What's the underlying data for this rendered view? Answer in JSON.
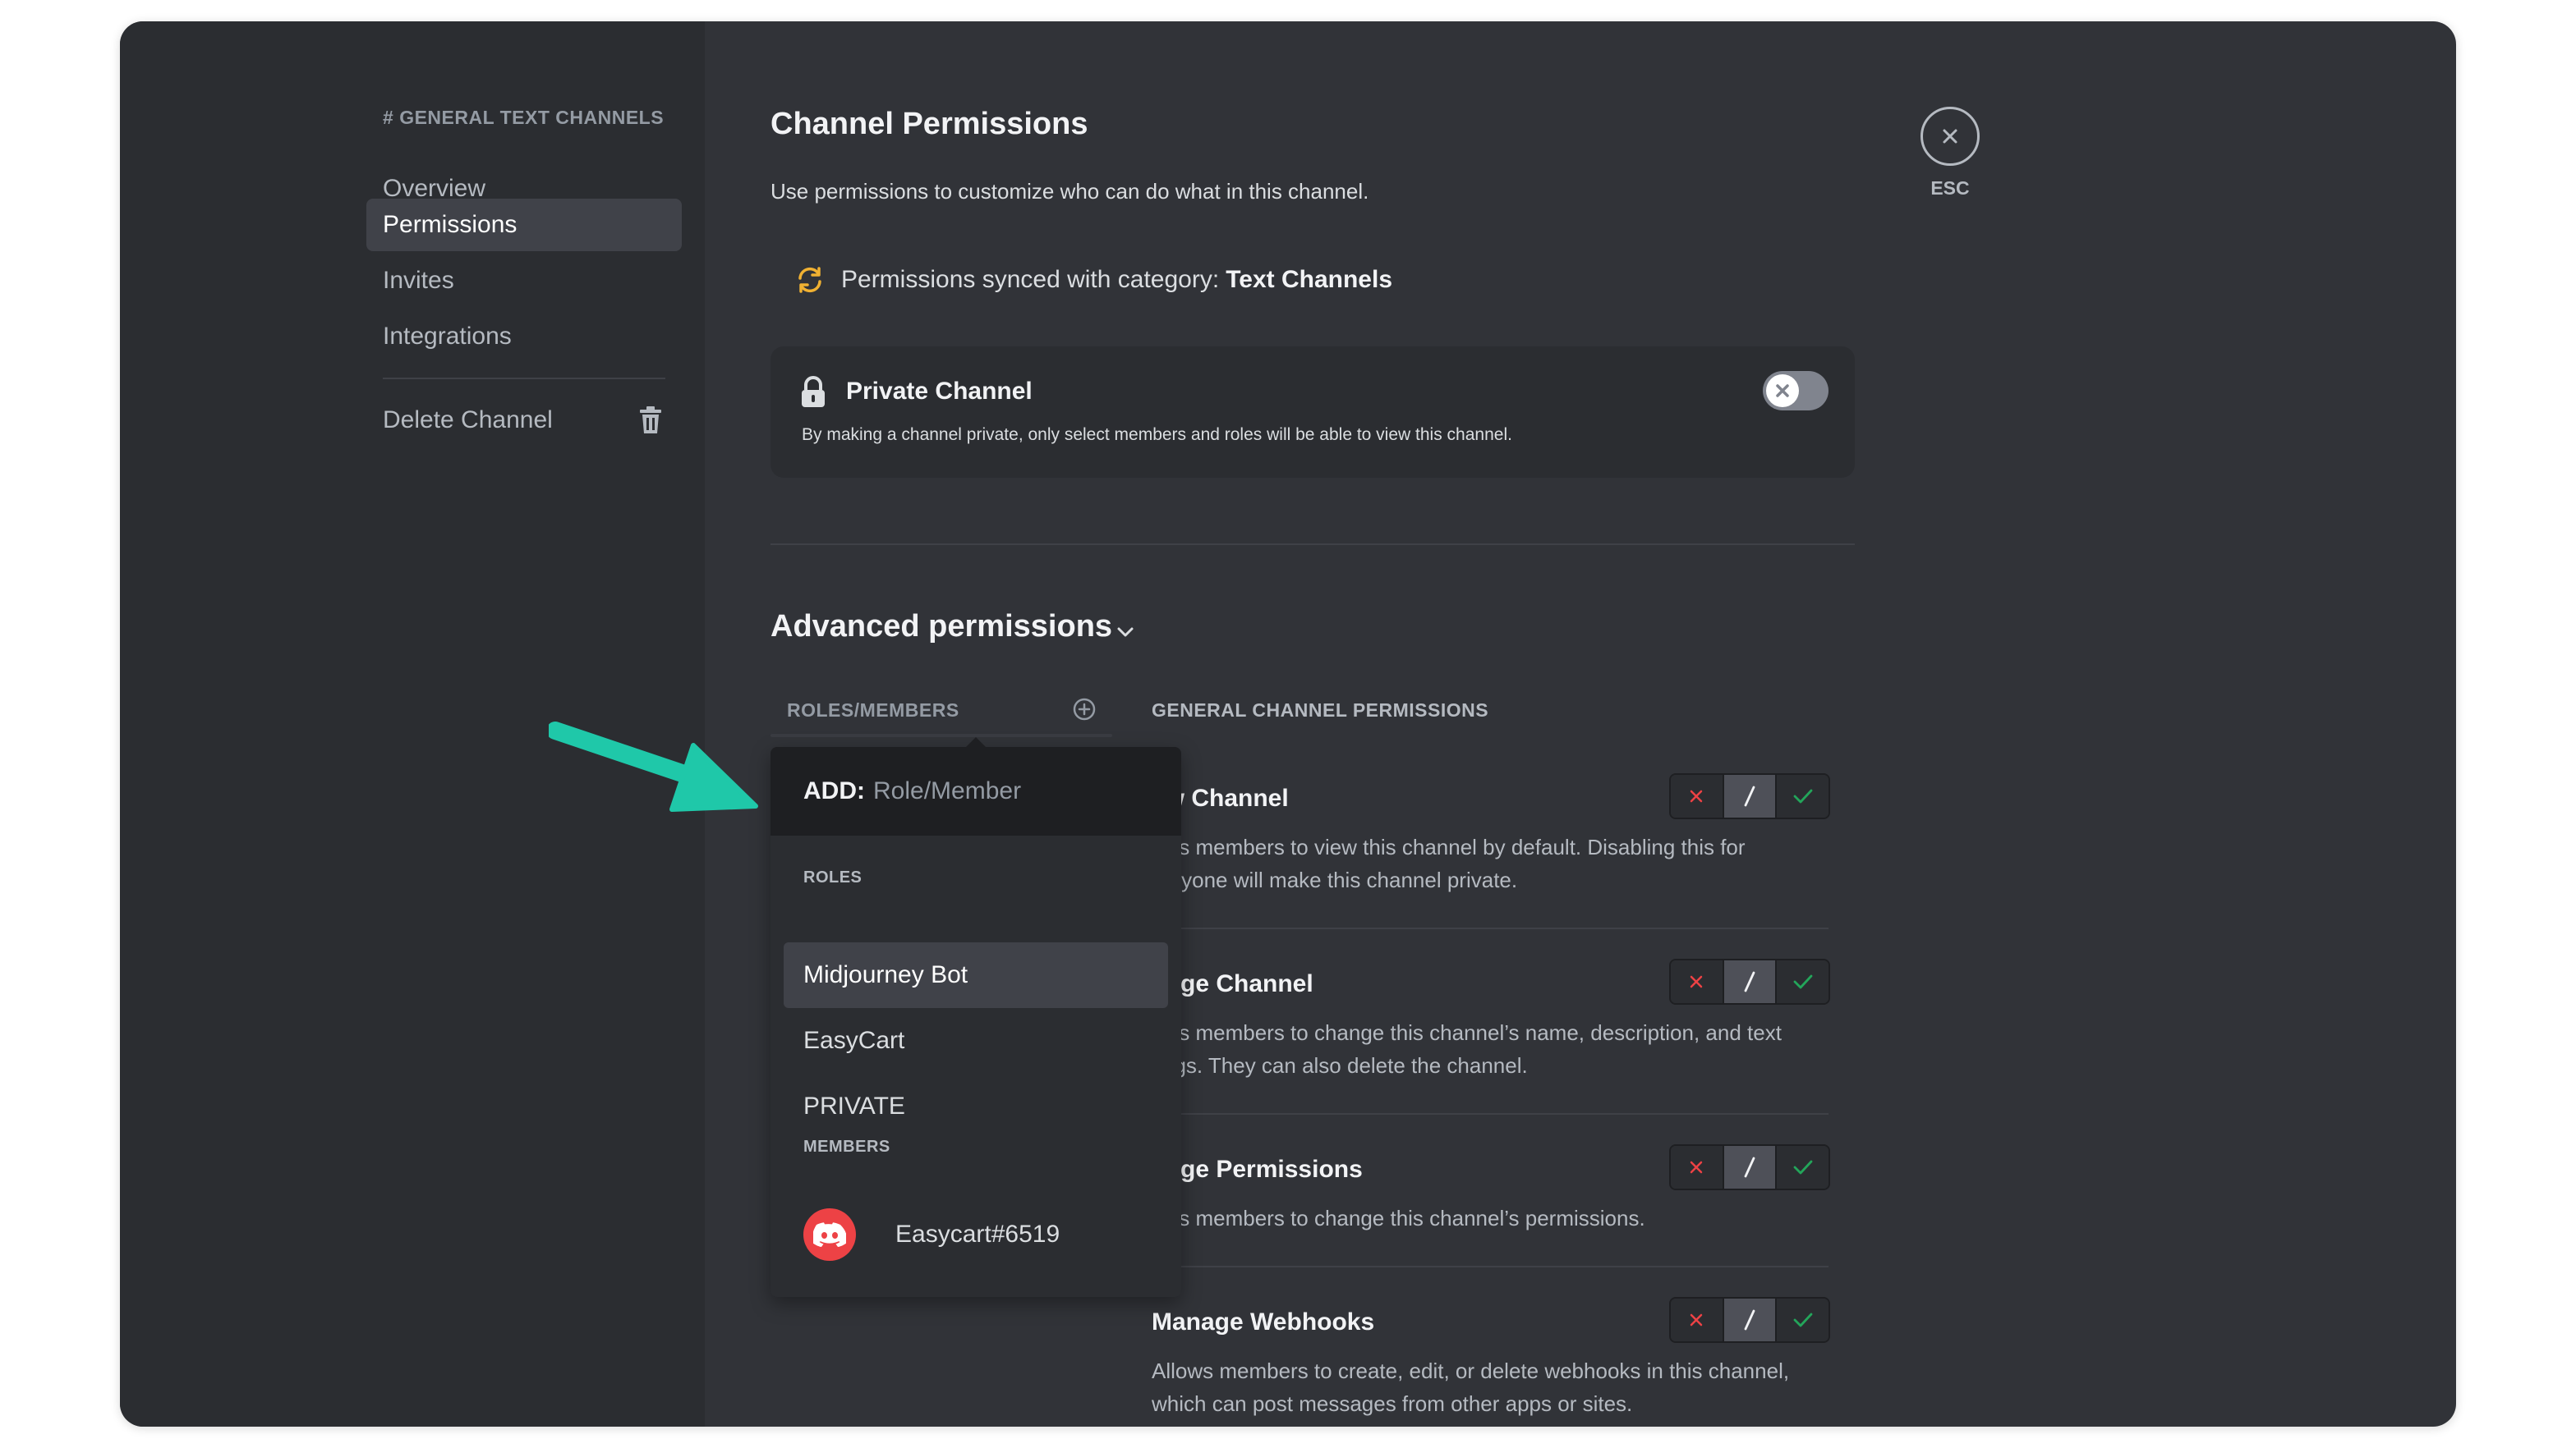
{
  "colors": {
    "accent_teal": "#1fc8a9",
    "deny_red": "#ed4245",
    "allow_green": "#23a55a",
    "sync_orange": "#f0b132"
  },
  "sidebar": {
    "header_hash": "#",
    "header": "GENERAL TEXT CHANNELS",
    "items": [
      {
        "label": "Overview"
      },
      {
        "label": "Permissions",
        "selected": true
      },
      {
        "label": "Invites"
      },
      {
        "label": "Integrations"
      }
    ],
    "delete_label": "Delete Channel",
    "delete_icon": "trash-icon"
  },
  "main": {
    "title": "Channel Permissions",
    "description": "Use permissions to customize who can do what in this channel.",
    "sync_prefix": "Permissions synced with category:",
    "sync_category": "Text Channels",
    "sync_icon": "sync-icon",
    "private_channel": {
      "title": "Private Channel",
      "description": "By making a channel private, only select members and roles will be able to view this channel.",
      "enabled": false
    },
    "advanced_title": "Advanced permissions",
    "roles_header": "ROLES/MEMBERS",
    "permissions_header": "GENERAL CHANNEL PERMISSIONS",
    "permissions": [
      {
        "name": "ew Channel",
        "desc_lines": [
          "ows members to view this channel by default. Disabling this for",
          "veryone will make this channel private."
        ],
        "state": "neutral"
      },
      {
        "name": "nage Channel",
        "desc_lines": [
          "ows members to change this channel’s name, description, and text",
          "tings. They can also delete the channel."
        ],
        "state": "neutral"
      },
      {
        "name": "nage Permissions",
        "desc_lines": [
          "ows members to change this channel’s permissions."
        ],
        "state": "neutral"
      },
      {
        "name": "Manage Webhooks",
        "desc_lines": [
          "Allows members to create, edit, or delete webhooks in this channel,",
          "which can post messages from other apps or sites."
        ],
        "state": "neutral"
      }
    ]
  },
  "popover": {
    "add_label": "ADD:",
    "search_placeholder": "Role/Member",
    "roles_header": "ROLES",
    "roles": [
      {
        "label": "Midjourney Bot",
        "highlighted": true
      },
      {
        "label": "EasyCart"
      },
      {
        "label": "PRIVATE"
      }
    ],
    "members_header": "MEMBERS",
    "members": [
      {
        "label": "Easycart#6519",
        "avatar_icon": "discord-logo-icon"
      }
    ]
  },
  "close": {
    "label": "ESC"
  }
}
